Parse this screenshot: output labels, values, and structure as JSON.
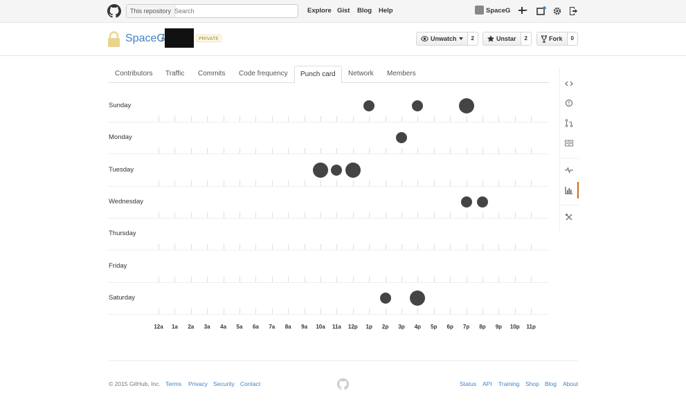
{
  "header": {
    "search_scope": "This repository",
    "search_placeholder": "Search",
    "nav": [
      "Explore",
      "Gist",
      "Blog",
      "Help"
    ],
    "username": "SpaceG"
  },
  "repo": {
    "owner": "SpaceG",
    "slash": "/",
    "private_label": "PRIVATE",
    "unwatch_label": "Unwatch",
    "unwatch_count": "2",
    "unstar_label": "Unstar",
    "star_count": "2",
    "fork_label": "Fork",
    "fork_count": "0"
  },
  "tabs": [
    "Contributors",
    "Traffic",
    "Commits",
    "Code frequency",
    "Punch card",
    "Network",
    "Members"
  ],
  "selected_tab": "Punch card",
  "chart_data": {
    "type": "scatter",
    "days": [
      "Sunday",
      "Monday",
      "Tuesday",
      "Wednesday",
      "Thursday",
      "Friday",
      "Saturday"
    ],
    "hours": [
      "12a",
      "1a",
      "2a",
      "3a",
      "4a",
      "5a",
      "6a",
      "7a",
      "8a",
      "9a",
      "10a",
      "11a",
      "12p",
      "1p",
      "2p",
      "3p",
      "4p",
      "5p",
      "6p",
      "7p",
      "8p",
      "9p",
      "10p",
      "11p"
    ],
    "points": [
      {
        "day": "Sunday",
        "hour": "1p",
        "size": 1
      },
      {
        "day": "Sunday",
        "hour": "4p",
        "size": 1
      },
      {
        "day": "Sunday",
        "hour": "7p",
        "size": 2
      },
      {
        "day": "Monday",
        "hour": "3p",
        "size": 1
      },
      {
        "day": "Tuesday",
        "hour": "10a",
        "size": 2
      },
      {
        "day": "Tuesday",
        "hour": "11a",
        "size": 1
      },
      {
        "day": "Tuesday",
        "hour": "12p",
        "size": 2
      },
      {
        "day": "Wednesday",
        "hour": "7p",
        "size": 1
      },
      {
        "day": "Wednesday",
        "hour": "8p",
        "size": 1
      },
      {
        "day": "Saturday",
        "hour": "2p",
        "size": 1
      },
      {
        "day": "Saturday",
        "hour": "4p",
        "size": 2
      }
    ]
  },
  "footer": {
    "copyright": "© 2015 GitHub, Inc.",
    "left_links": [
      "Terms",
      "Privacy",
      "Security",
      "Contact"
    ],
    "right_links": [
      "Status",
      "API",
      "Training",
      "Shop",
      "Blog",
      "About"
    ]
  },
  "colors": {
    "link": "#4183c4",
    "dot": "#444444",
    "active_side": "#d26911"
  }
}
